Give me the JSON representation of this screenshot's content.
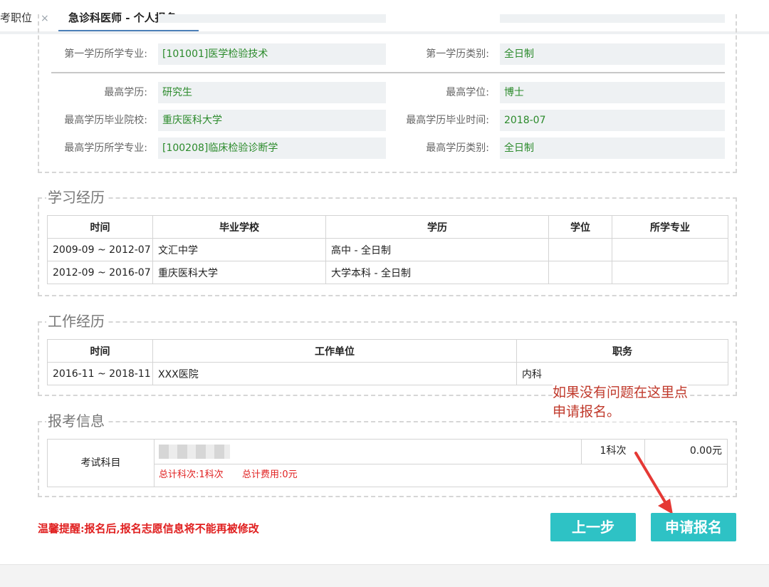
{
  "tabs": [
    {
      "label": "考职位",
      "close": "×"
    },
    {
      "label": "急诊科医师 - 个人报名",
      "close": "×"
    }
  ],
  "first_degree": {
    "major_label": "第一学历所学专业:",
    "major_value": "[101001]医学检验技术",
    "type_label": "第一学历类别:",
    "type_value": "全日制"
  },
  "highest": {
    "edu_label": "最高学历:",
    "edu_value": "研究生",
    "degree_label": "最高学位:",
    "degree_value": "博士",
    "school_label": "最高学历毕业院校:",
    "school_value": "重庆医科大学",
    "grad_time_label": "最高学历毕业时间:",
    "grad_time_value": "2018-07",
    "major_label": "最高学历所学专业:",
    "major_value": "[100208]临床检验诊断学",
    "type_label": "最高学历类别:",
    "type_value": "全日制"
  },
  "study": {
    "title": "学习经历",
    "headers": [
      "时间",
      "毕业学校",
      "学历",
      "学位",
      "所学专业"
    ],
    "rows": [
      [
        "2009-09 ~ 2012-07",
        "文汇中学",
        "高中 - 全日制",
        "",
        ""
      ],
      [
        "2012-09 ~ 2016-07",
        "重庆医科大学",
        "大学本科 - 全日制",
        "",
        ""
      ]
    ]
  },
  "work": {
    "title": "工作经历",
    "headers": [
      "时间",
      "工作单位",
      "职务"
    ],
    "rows": [
      [
        "2016-11 ~ 2018-11",
        "XXX医院",
        "内科"
      ]
    ]
  },
  "apply": {
    "title": "报考信息",
    "subject_label": "考试科目",
    "count": "1科次",
    "fee": "0.00元",
    "total_count_label": "总计科次:",
    "total_count": "1科次",
    "total_fee_label": "总计费用:",
    "total_fee": "0元"
  },
  "reminder": "温馨提醒:报名后,报名志愿信息将不能再被修改",
  "annotation": [
    "如果没有问题在这里点",
    "申请报名。"
  ],
  "buttons": {
    "prev": "上一步",
    "submit": "申请报名"
  },
  "colors": {
    "accent": "#2ec2c5",
    "value_text": "#2b8a2b",
    "warning": "#e02020",
    "annotation": "#c0392b"
  }
}
